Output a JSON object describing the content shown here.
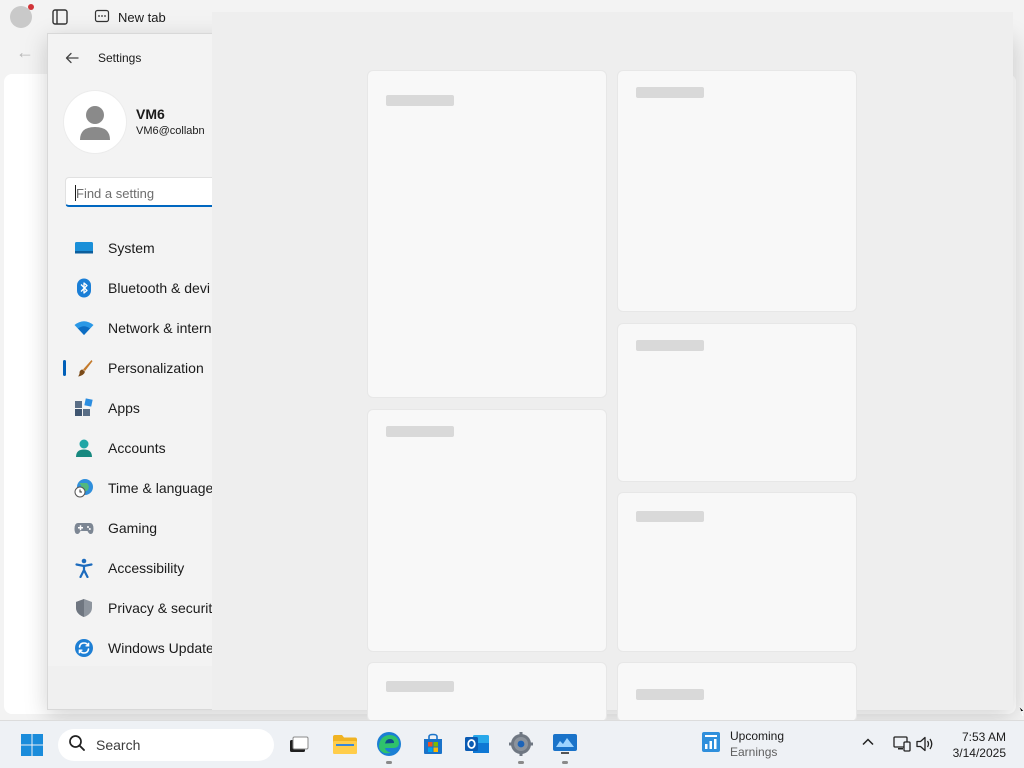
{
  "browser": {
    "tab_title": "New tab",
    "back_glyph": "←"
  },
  "settings": {
    "title": "Settings",
    "user": {
      "name": "VM6",
      "email": "VM6@collabn"
    },
    "search": {
      "placeholder": "Find a setting",
      "value": ""
    },
    "nav_items": [
      {
        "label": "System",
        "icon": "system-icon"
      },
      {
        "label": "Bluetooth & devi",
        "icon": "bluetooth-icon"
      },
      {
        "label": "Network & intern",
        "icon": "network-icon"
      },
      {
        "label": "Personalization",
        "icon": "personalization-brush-icon",
        "selected": true
      },
      {
        "label": "Apps",
        "icon": "apps-icon"
      },
      {
        "label": "Accounts",
        "icon": "accounts-icon"
      },
      {
        "label": "Time & language",
        "icon": "time-language-icon"
      },
      {
        "label": "Gaming",
        "icon": "gaming-icon"
      },
      {
        "label": "Accessibility",
        "icon": "accessibility-icon"
      },
      {
        "label": "Privacy & securit",
        "icon": "privacy-shield-icon"
      },
      {
        "label": "Windows Update",
        "icon": "windows-update-icon"
      }
    ],
    "content_state": "loading"
  },
  "taskbar": {
    "search_label": "Search",
    "apps": [
      "task-view",
      "file-explorer",
      "edge",
      "microsoft-store",
      "outlook",
      "settings",
      "remote-desktop"
    ],
    "widget": {
      "title": "Upcoming",
      "subtitle": "Earnings"
    },
    "clock": {
      "time": "7:53 AM",
      "date": "3/14/2025"
    }
  },
  "colors": {
    "accent": "#005fb8",
    "taskbar_bg": "#eef1f5",
    "content_bg": "#eeeeee",
    "skeleton": "#d9d9d9"
  }
}
